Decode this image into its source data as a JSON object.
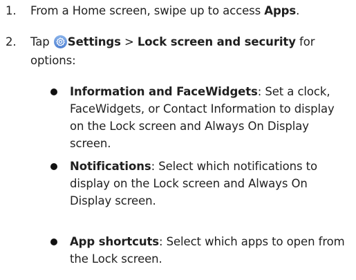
{
  "steps": [
    {
      "number": "1.",
      "text_before": "From a Home screen, swipe up to access ",
      "bold": "Apps",
      "text_after": "."
    },
    {
      "number": "2.",
      "text_before": "Tap ",
      "icon": "settings-gear-icon",
      "bold_1": "Settings",
      "separator": " > ",
      "bold_2": "Lock screen and security",
      "text_after": " for options:"
    }
  ],
  "bullets": [
    {
      "term": "Information and FaceWidgets",
      "description": ": Set a clock, FaceWidgets, or Contact Information to display on the Lock screen and Always On Display screen."
    },
    {
      "term": "Notifications",
      "description": ": Select which notifications to display on the Lock screen and Always On Display screen."
    },
    {
      "term": "App shortcuts",
      "description": ": Select which apps to open from the Lock screen."
    }
  ],
  "colors": {
    "icon_gradient_top": "#8ab3ea",
    "icon_gradient_bottom": "#4d7fd2",
    "text": "#1f1f1f"
  }
}
